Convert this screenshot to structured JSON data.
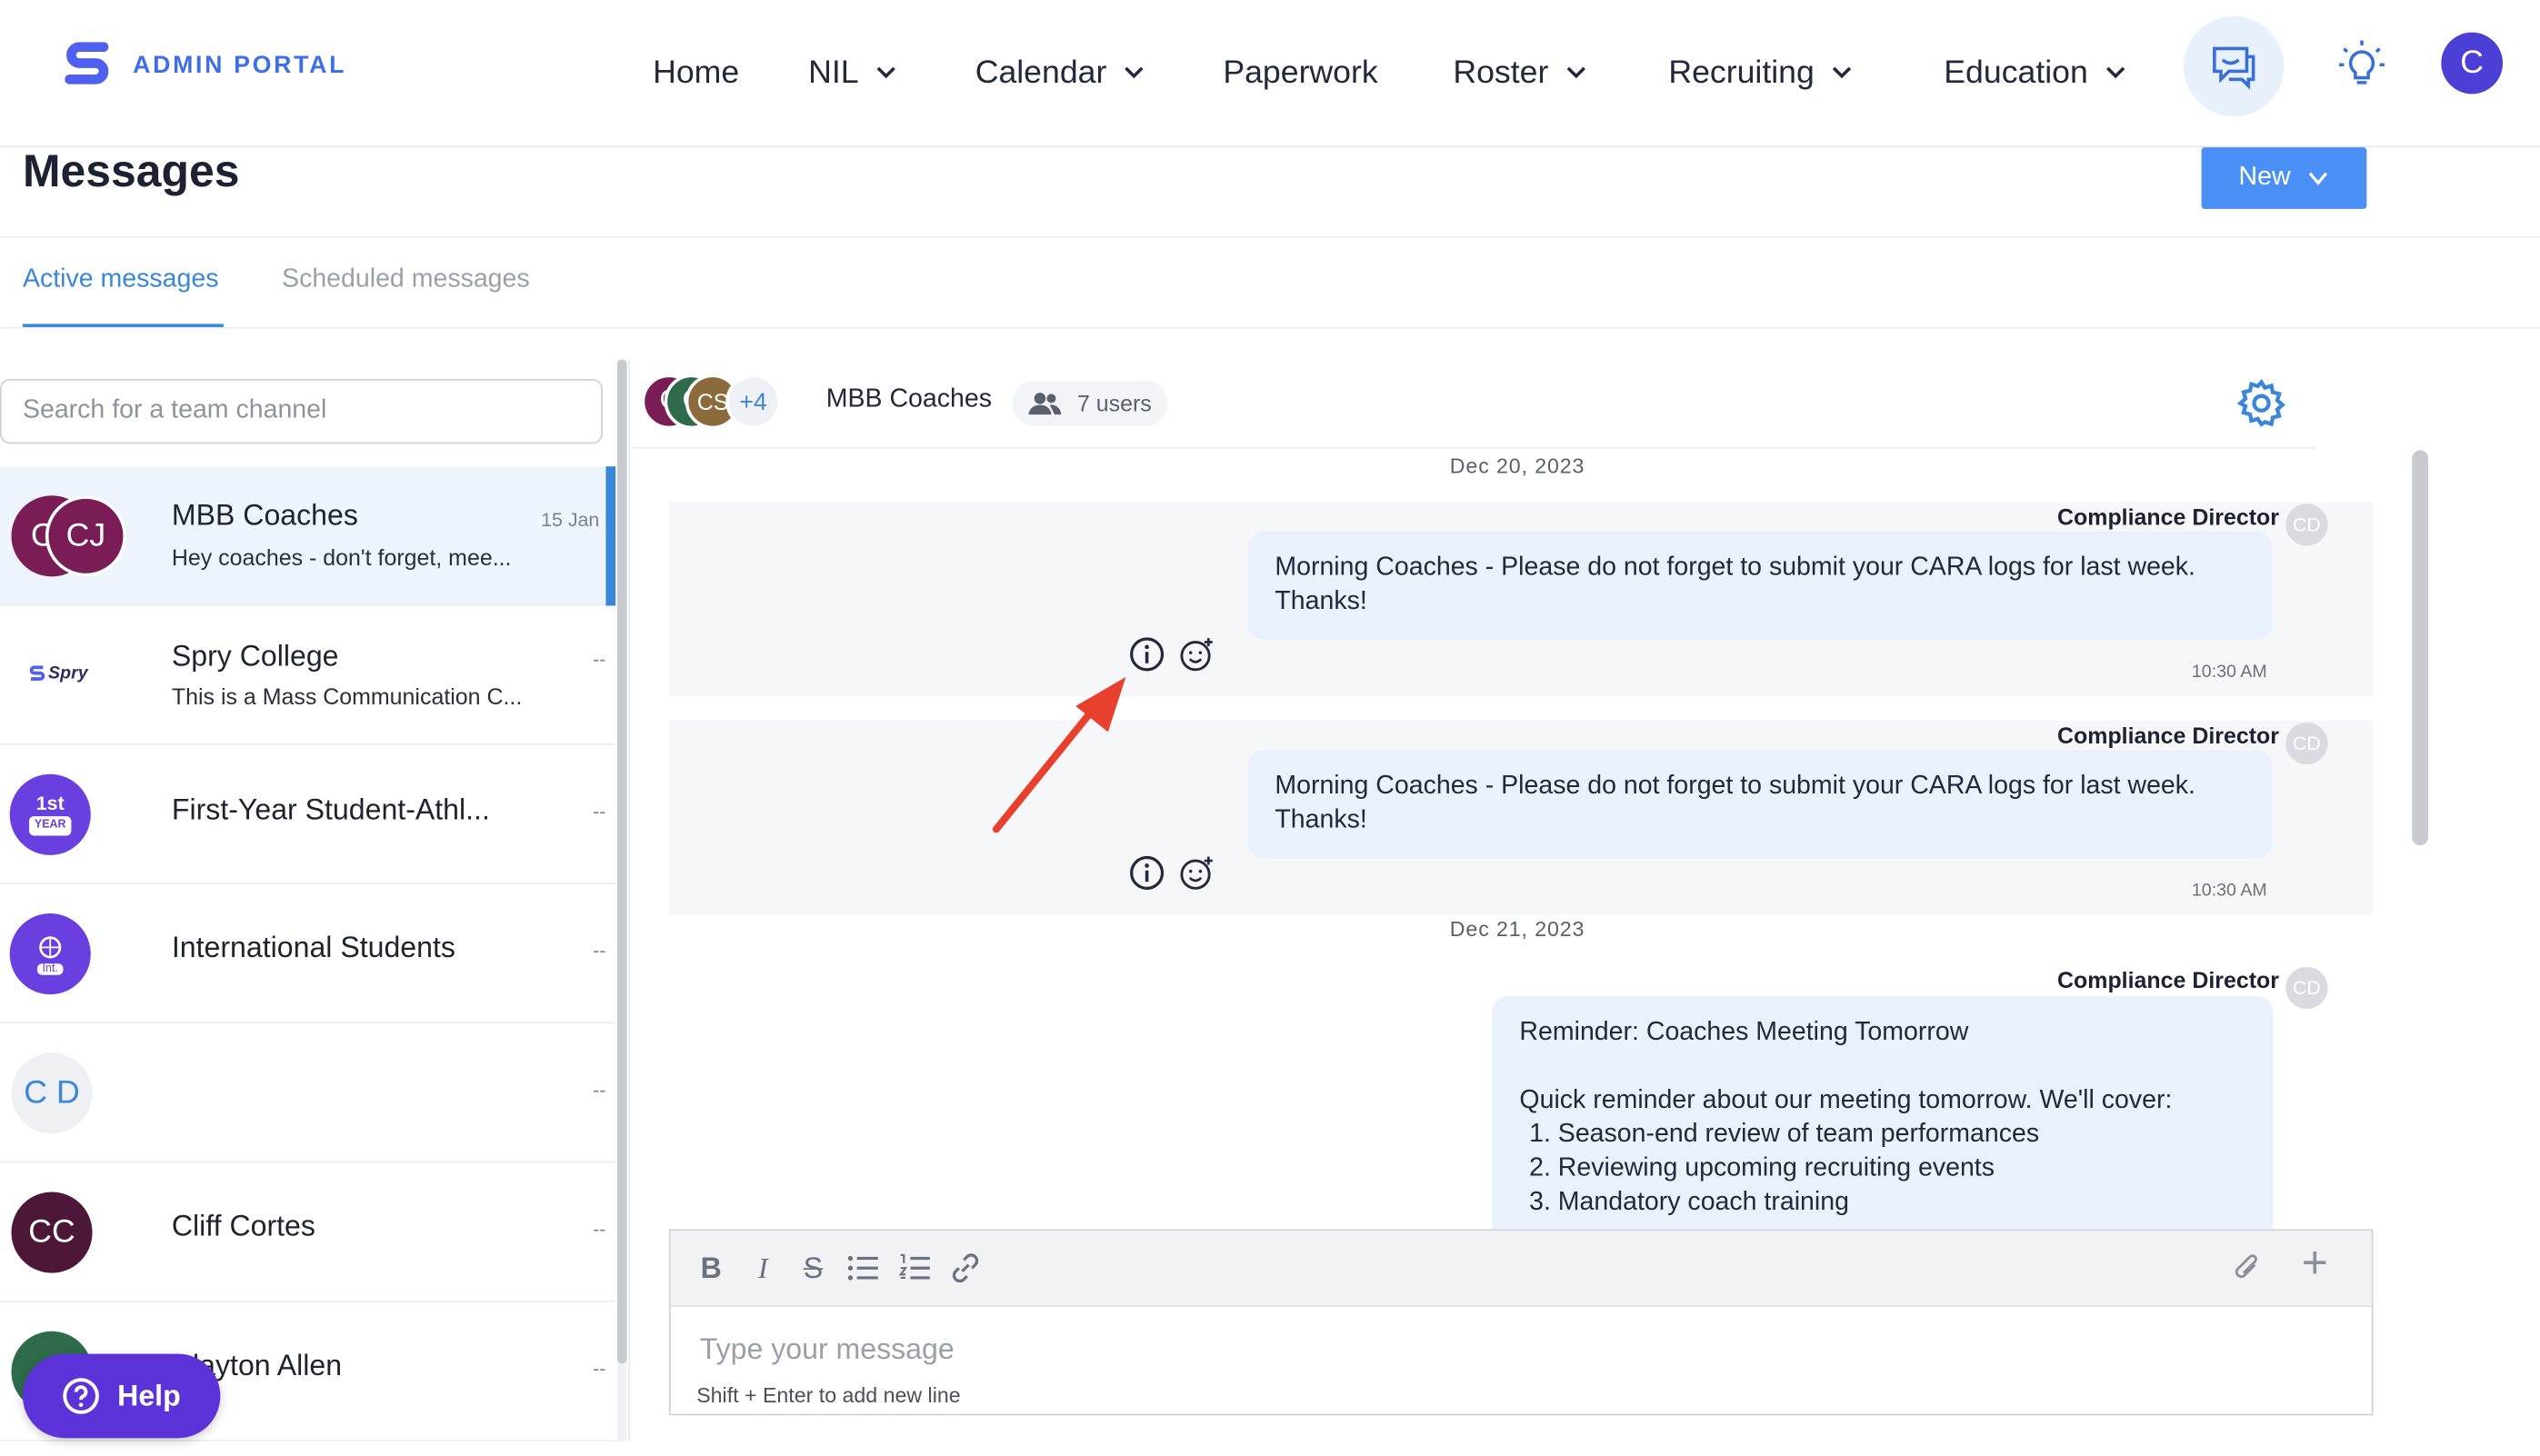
{
  "brand": {
    "name": "ADMIN PORTAL"
  },
  "nav": {
    "home": "Home",
    "nil": "NIL",
    "calendar": "Calendar",
    "paperwork": "Paperwork",
    "roster": "Roster",
    "recruiting": "Recruiting",
    "education": "Education",
    "user_initial": "C"
  },
  "page": {
    "title": "Messages",
    "new_label": "New"
  },
  "tabs": {
    "active": "Active messages",
    "scheduled": "Scheduled messages"
  },
  "search": {
    "placeholder": "Search for a team channel"
  },
  "channels": [
    {
      "name": "MBB Coaches",
      "preview": "Hey coaches - don't forget, mee...",
      "meta": "15 Jan",
      "avatar_text": "CJ",
      "avatar_back_text": "C"
    },
    {
      "name": "Spry College",
      "preview": "This is a Mass Communication C...",
      "meta": "--",
      "avatar_text": "Spry"
    },
    {
      "name": "First-Year Student-Athl...",
      "preview": "",
      "meta": "--",
      "avatar_text": "1st",
      "avatar_sub": "YEAR"
    },
    {
      "name": "International Students",
      "preview": "",
      "meta": "--",
      "avatar_sub": "Int."
    },
    {
      "name": "",
      "preview": "",
      "meta": "--",
      "avatar_text": "C D"
    },
    {
      "name": "Cliff Cortes",
      "preview": "",
      "meta": "--",
      "avatar_text": "CC"
    },
    {
      "name": "Clayton Allen",
      "preview": "",
      "meta": "--",
      "avatar_text": "C"
    }
  ],
  "chat": {
    "name": "MBB Coaches",
    "users": "7 users",
    "member_avatars": [
      "C",
      "C",
      "CS"
    ],
    "more": "+4"
  },
  "messages": [
    {
      "date": "Dec 20, 2023",
      "sender": "Compliance Director",
      "initials": "CD",
      "line1": "Morning Coaches - Please do not forget to submit your CARA logs for last week.",
      "line2": "Thanks!",
      "time": "10:30 AM"
    },
    {
      "sender": "Compliance Director",
      "initials": "CD",
      "line1": "Morning Coaches - Please do not forget to submit your CARA logs for last week.",
      "line2": "Thanks!",
      "time": "10:30 AM"
    },
    {
      "date": "Dec 21, 2023",
      "sender": "Compliance Director",
      "initials": "CD",
      "title": "Reminder: Coaches Meeting Tomorrow",
      "intro": "Quick reminder about our meeting tomorrow. We'll cover:",
      "items": [
        "1. Season-end review of team performances",
        "2. Reviewing upcoming recruiting events",
        "3. Mandatory coach training"
      ]
    }
  ],
  "composer": {
    "placeholder": "Type your message",
    "hint": "Shift + Enter to add new line"
  },
  "help": {
    "label": "Help"
  },
  "colors": {
    "accent": "#3a86d8",
    "new_button": "#4a8ff5",
    "help": "#5b33d9",
    "annotation_arrow": "#e8402f"
  }
}
